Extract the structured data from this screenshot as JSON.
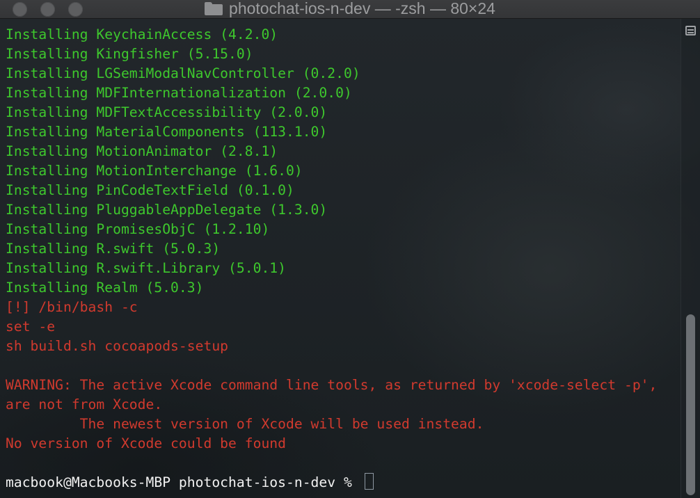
{
  "window": {
    "title": "photochat-ios-n-dev — -zsh — 80×24"
  },
  "colors": {
    "success": "#3ec82d",
    "error": "#d13a2e",
    "prompt": "#f2f2f2",
    "background": "#1d2226"
  },
  "terminal": {
    "lines": [
      {
        "text": "Installing KeychainAccess (4.2.0)",
        "style": "green"
      },
      {
        "text": "Installing Kingfisher (5.15.0)",
        "style": "green"
      },
      {
        "text": "Installing LGSemiModalNavController (0.2.0)",
        "style": "green"
      },
      {
        "text": "Installing MDFInternationalization (2.0.0)",
        "style": "green"
      },
      {
        "text": "Installing MDFTextAccessibility (2.0.0)",
        "style": "green"
      },
      {
        "text": "Installing MaterialComponents (113.1.0)",
        "style": "green"
      },
      {
        "text": "Installing MotionAnimator (2.8.1)",
        "style": "green"
      },
      {
        "text": "Installing MotionInterchange (1.6.0)",
        "style": "green"
      },
      {
        "text": "Installing PinCodeTextField (0.1.0)",
        "style": "green"
      },
      {
        "text": "Installing PluggableAppDelegate (1.3.0)",
        "style": "green"
      },
      {
        "text": "Installing PromisesObjC (1.2.10)",
        "style": "green"
      },
      {
        "text": "Installing R.swift (5.0.3)",
        "style": "green"
      },
      {
        "text": "Installing R.swift.Library (5.0.1)",
        "style": "green"
      },
      {
        "text": "Installing Realm (5.0.3)",
        "style": "green"
      },
      {
        "text": "[!] /bin/bash -c",
        "style": "red"
      },
      {
        "text": "set -e",
        "style": "red"
      },
      {
        "text": "sh build.sh cocoapods-setup",
        "style": "red"
      },
      {
        "text": "",
        "style": "red"
      },
      {
        "text": "WARNING: The active Xcode command line tools, as returned by 'xcode-select -p',",
        "style": "red"
      },
      {
        "text": "are not from Xcode.",
        "style": "red"
      },
      {
        "text": "         The newest version of Xcode will be used instead.",
        "style": "red"
      },
      {
        "text": "No version of Xcode could be found",
        "style": "red"
      },
      {
        "text": "",
        "style": "red"
      }
    ],
    "prompt": "macbook@Macbooks-MBP photochat-ios-n-dev % "
  },
  "icons": {
    "title_icon": "folder-icon",
    "scroll_menu_icon": "menu-icon"
  }
}
